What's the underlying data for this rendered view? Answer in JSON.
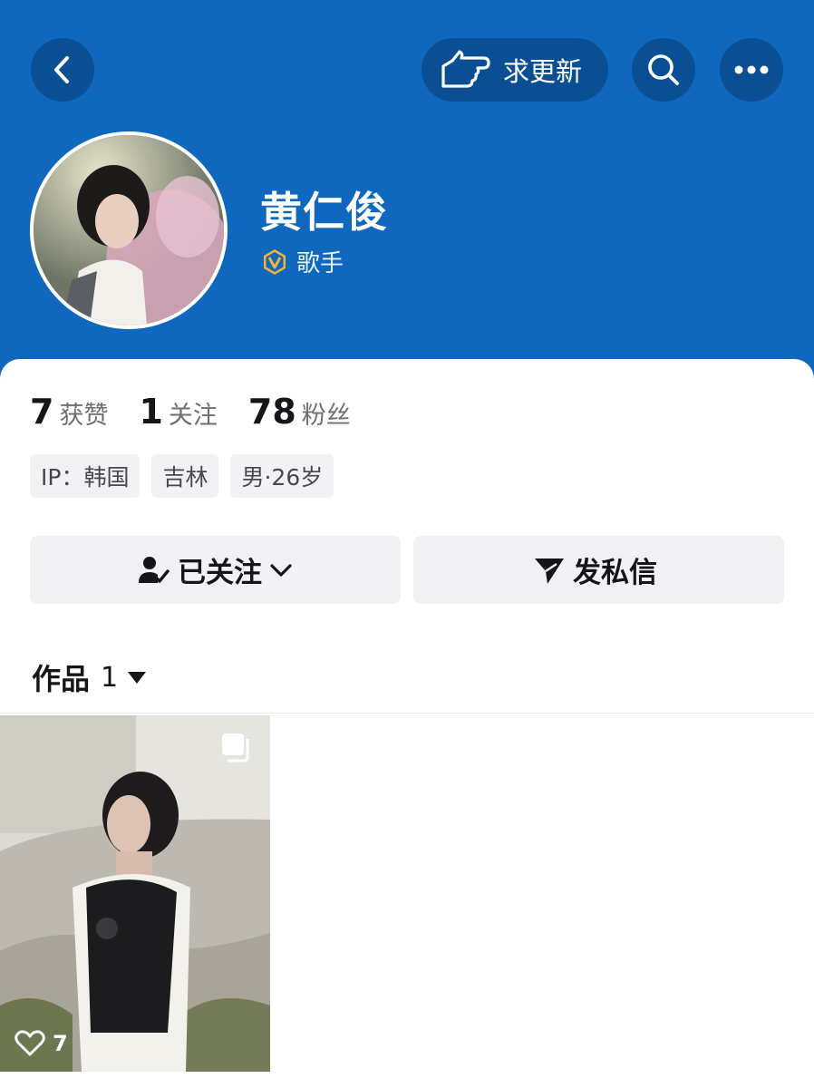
{
  "header": {
    "request_update_label": "求更新",
    "name": "黄仁俊",
    "verified_title": "歌手"
  },
  "stats": {
    "likes_num": "7",
    "likes_label": "获赞",
    "following_num": "1",
    "following_label": "关注",
    "followers_num": "78",
    "followers_label": "粉丝"
  },
  "tags": [
    "IP：韩国",
    "吉林",
    "男·26岁"
  ],
  "actions": {
    "followed_label": "已关注",
    "message_label": "发私信"
  },
  "works": {
    "tab_label": "作品",
    "count": "1",
    "items": [
      {
        "like_count": "7"
      }
    ]
  },
  "colors": {
    "header_bg": "#0f68bd",
    "header_btn_bg": "#0a4f94",
    "verify_badge": "#f0b43c"
  }
}
